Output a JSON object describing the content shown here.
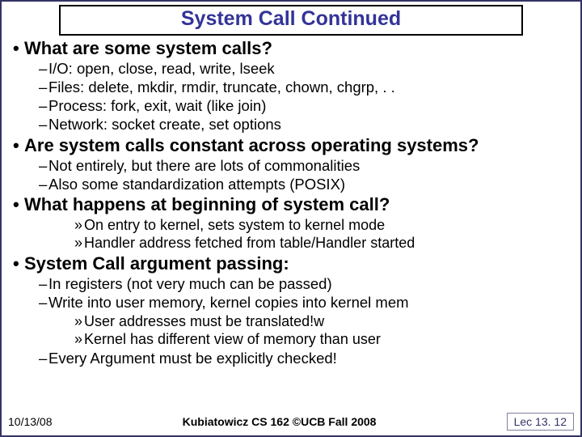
{
  "title": "System Call Continued",
  "b1": {
    "q": "What are some system calls?",
    "i0": "I/O: open, close, read, write, lseek",
    "i1": "Files: delete, mkdir, rmdir, truncate, chown, chgrp, . .",
    "i2": "Process: fork, exit, wait (like join)",
    "i3": "Network: socket create, set options"
  },
  "b2": {
    "q": "Are system calls constant across operating systems?",
    "i0": "Not entirely, but there are lots of commonalities",
    "i1": "Also some standardization attempts (POSIX)"
  },
  "b3": {
    "q": "What happens at beginning of system call?",
    "i0": "On entry to kernel, sets system to kernel mode",
    "i1": "Handler address fetched from table/Handler started"
  },
  "b4": {
    "q": "System Call argument passing:",
    "i0": "In registers (not very much can be passed)",
    "i1": "Write into user memory, kernel copies into kernel mem",
    "s0": "User addresses must be translated!w",
    "s1": "Kernel has different view of memory than user",
    "i2": "Every Argument must be explicitly checked!"
  },
  "footer": {
    "date": "10/13/08",
    "center": "Kubiatowicz CS 162 ©UCB Fall 2008",
    "right": "Lec 13. 12"
  }
}
